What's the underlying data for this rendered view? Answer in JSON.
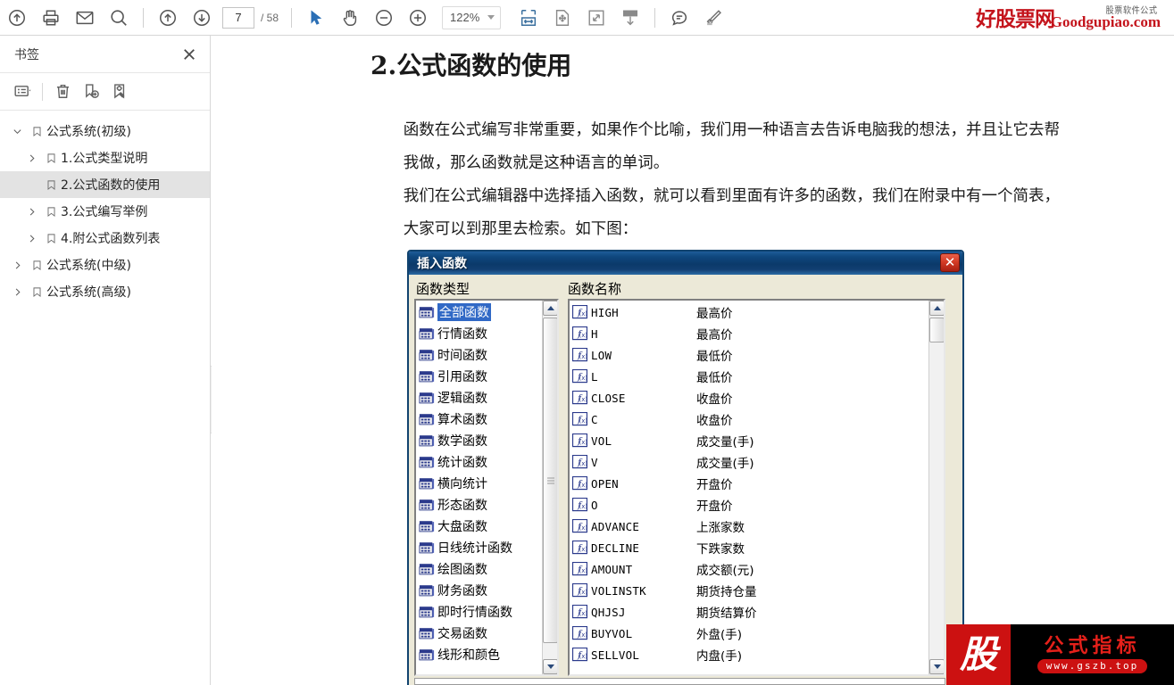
{
  "toolbar": {
    "buttons": [
      {
        "name": "upload-icon",
        "label": "Upload"
      },
      {
        "name": "print-icon",
        "label": "Print"
      },
      {
        "name": "email-icon",
        "label": "Email"
      },
      {
        "name": "search-icon",
        "label": "Search"
      },
      {
        "name": "page-up-icon",
        "label": "Previous Page"
      },
      {
        "name": "page-down-icon",
        "label": "Next Page"
      },
      {
        "name": "select-tool-icon",
        "label": "Select"
      },
      {
        "name": "hand-tool-icon",
        "label": "Pan"
      },
      {
        "name": "zoom-out-icon",
        "label": "Zoom Out"
      },
      {
        "name": "zoom-in-icon",
        "label": "Zoom In"
      },
      {
        "name": "fit-width-icon",
        "label": "Fit Width"
      },
      {
        "name": "fit-page-icon",
        "label": "Fit Page"
      },
      {
        "name": "fullscreen-icon",
        "label": "Full Screen"
      },
      {
        "name": "snapshot-icon",
        "label": "Snapshot"
      },
      {
        "name": "comment-icon",
        "label": "Comment"
      },
      {
        "name": "highlight-icon",
        "label": "Highlight"
      }
    ],
    "page_current": "7",
    "page_total": "/ 58",
    "zoom_value": "122%"
  },
  "brand": {
    "sup": "股票软件公式",
    "cn": "好股票网",
    "en": "Goodgupiao.com",
    "color": "#c4141c"
  },
  "sidebar": {
    "title": "书签",
    "close_label": "×",
    "tools": [
      {
        "name": "list-options-icon",
        "label": "Options"
      },
      {
        "name": "delete-bookmark-icon",
        "label": "Delete"
      },
      {
        "name": "add-bookmark-icon",
        "label": "Add Bookmark"
      },
      {
        "name": "edit-bookmark-icon",
        "label": "Edit Bookmark"
      }
    ],
    "bookmarks": [
      {
        "label": "公式系统(初级)",
        "level": 0,
        "arrow": "down",
        "selected": false
      },
      {
        "label": "1.公式类型说明",
        "level": 1,
        "arrow": "right",
        "selected": false
      },
      {
        "label": "2.公式函数的使用",
        "level": 1,
        "arrow": "none",
        "selected": true
      },
      {
        "label": "3.公式编写举例",
        "level": 1,
        "arrow": "right",
        "selected": false
      },
      {
        "label": "4.附公式函数列表",
        "level": 1,
        "arrow": "right",
        "selected": false
      },
      {
        "label": "公式系统(中级)",
        "level": 0,
        "arrow": "right",
        "selected": false
      },
      {
        "label": "公式系统(高级)",
        "level": 0,
        "arrow": "right",
        "selected": false
      }
    ],
    "collapse_handle": "collapse-sidebar"
  },
  "document": {
    "heading": "2.公式函数的使用",
    "paragraph1": "函数在公式编写非常重要，如果作个比喻，我们用一种语言去告诉电脑我的想法，并且让它去帮我做，那么函数就是这种语言的单词。",
    "paragraph2": "我们在公式编辑器中选择插入函数，就可以看到里面有许多的函数，我们在附录中有一个简表，大家可以到那里去检索。如下图："
  },
  "dialog": {
    "title": "插入函数",
    "close_label": "✕",
    "label_type": "函数类型",
    "label_name": "函数名称",
    "categories": [
      {
        "label": "全部函数",
        "selected": true
      },
      {
        "label": "行情函数",
        "selected": false
      },
      {
        "label": "时间函数",
        "selected": false
      },
      {
        "label": "引用函数",
        "selected": false
      },
      {
        "label": "逻辑函数",
        "selected": false
      },
      {
        "label": "算术函数",
        "selected": false
      },
      {
        "label": "数学函数",
        "selected": false
      },
      {
        "label": "统计函数",
        "selected": false
      },
      {
        "label": "横向统计",
        "selected": false
      },
      {
        "label": "形态函数",
        "selected": false
      },
      {
        "label": "大盘函数",
        "selected": false
      },
      {
        "label": "日线统计函数",
        "selected": false
      },
      {
        "label": "绘图函数",
        "selected": false
      },
      {
        "label": "财务函数",
        "selected": false
      },
      {
        "label": "即时行情函数",
        "selected": false
      },
      {
        "label": "交易函数",
        "selected": false
      },
      {
        "label": "线形和颜色",
        "selected": false
      }
    ],
    "functions": [
      {
        "name": "HIGH",
        "desc": "最高价"
      },
      {
        "name": "H",
        "desc": "最高价"
      },
      {
        "name": "LOW",
        "desc": "最低价"
      },
      {
        "name": "L",
        "desc": "最低价"
      },
      {
        "name": "CLOSE",
        "desc": "收盘价"
      },
      {
        "name": "C",
        "desc": "收盘价"
      },
      {
        "name": "VOL",
        "desc": "成交量(手)"
      },
      {
        "name": "V",
        "desc": "成交量(手)"
      },
      {
        "name": "OPEN",
        "desc": "开盘价"
      },
      {
        "name": "O",
        "desc": "开盘价"
      },
      {
        "name": "ADVANCE",
        "desc": "上涨家数"
      },
      {
        "name": "DECLINE",
        "desc": "下跌家数"
      },
      {
        "name": "AMOUNT",
        "desc": "成交额(元)"
      },
      {
        "name": "VOLINSTK",
        "desc": "期货持仓量"
      },
      {
        "name": "QHJSJ",
        "desc": "期货结算价"
      },
      {
        "name": "BUYVOL",
        "desc": "外盘(手)"
      },
      {
        "name": "SELLVOL",
        "desc": "内盘(手)"
      }
    ]
  },
  "banner": {
    "mark": "股",
    "cn": "公式指标",
    "url": "www.gszb.top",
    "red": "#cc1111",
    "black": "#000000"
  }
}
